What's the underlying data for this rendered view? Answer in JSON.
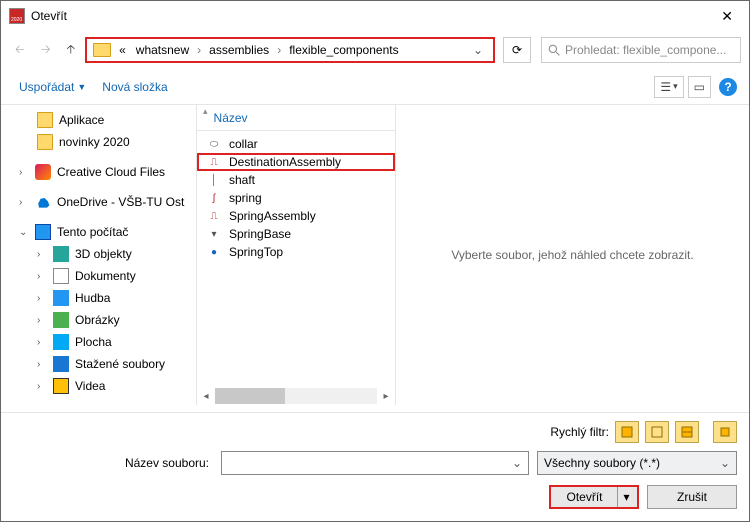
{
  "title": "Otevřít",
  "breadcrumb": {
    "root": "«",
    "p1": "whatsnew",
    "p2": "assemblies",
    "p3": "flexible_components"
  },
  "search": {
    "placeholder": "Prohledat: flexible_compone..."
  },
  "toolbar": {
    "organize": "Uspořádat",
    "newfolder": "Nová složka"
  },
  "tree": {
    "aplikace": "Aplikace",
    "novinky": "novinky 2020",
    "cc": "Creative Cloud Files",
    "onedrive": "OneDrive - VŠB-TU Ost",
    "pc": "Tento počítač",
    "obj3d": "3D objekty",
    "docs": "Dokumenty",
    "music": "Hudba",
    "pics": "Obrázky",
    "desk": "Plocha",
    "dl": "Stažené soubory",
    "vid": "Videa"
  },
  "col": {
    "name": "Název"
  },
  "files": {
    "f0": "collar",
    "f1": "DestinationAssembly",
    "f2": "shaft",
    "f3": "spring",
    "f4": "SpringAssembly",
    "f5": "SpringBase",
    "f6": "SpringTop"
  },
  "preview": "Vyberte soubor, jehož náhled chcete zobrazit.",
  "footer": {
    "qfilter": "Rychlý filtr:",
    "fname": "Název souboru:",
    "ftype": "Všechny soubory (*.*)",
    "open": "Otevřít",
    "cancel": "Zrušit"
  }
}
